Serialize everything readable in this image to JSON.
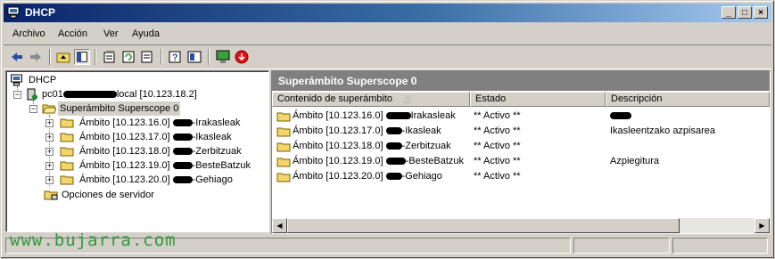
{
  "window": {
    "title": "DHCP",
    "controls": [
      "_",
      "□",
      "×"
    ]
  },
  "menu": {
    "items": [
      {
        "label": "Archivo"
      },
      {
        "label": "Acción"
      },
      {
        "label": "Ver"
      },
      {
        "label": "Ayuda"
      }
    ]
  },
  "toolbar": {
    "buttons": [
      "back-arrow-icon",
      "forward-arrow-icon",
      "up-folder-icon",
      "show-tree-icon",
      "properties-icon",
      "refresh-icon",
      "export-list-icon",
      "help-icon",
      "mmc-help-icon",
      "monitor-icon",
      "stop-icon"
    ]
  },
  "tree": {
    "root": "DHCP",
    "server": {
      "prefix": "pc01",
      "suffix": "local [10.123.18.2]"
    },
    "superscope": "Superámbito Superscope 0",
    "scopes": [
      {
        "pre": "Ámbito [10.123.16.0] ",
        "post": "-Irakasleak"
      },
      {
        "pre": "Ámbito [10.123.17.0] ",
        "post": "-Ikasleak"
      },
      {
        "pre": "Ámbito [10.123.18.0] ",
        "post": "-Zerbitzuak"
      },
      {
        "pre": "Ámbito [10.123.19.0] ",
        "post": "-BesteBatzuk"
      },
      {
        "pre": "Ámbito [10.123.20.0] ",
        "post": "-Gehiago"
      }
    ],
    "server_options": "Opciones de servidor"
  },
  "details": {
    "header": "Superámbito Superscope 0",
    "columns": [
      "Contenido de superámbito",
      "Estado",
      "Descripción"
    ],
    "rows": [
      {
        "name_pre": "Ámbito [10.123.16.0] ",
        "name_post": "Irakasleak",
        "status": "** Activo **",
        "description": ""
      },
      {
        "name_pre": "Ámbito [10.123.17.0] ",
        "name_post": "-Ikasleak",
        "status": "** Activo **",
        "description": "Ikasleentzako azpisarea"
      },
      {
        "name_pre": "Ámbito [10.123.18.0] ",
        "name_post": "-Zerbitzuak",
        "status": "** Activo **",
        "description": ""
      },
      {
        "name_pre": "Ámbito [10.123.19.0] ",
        "name_post": "-BesteBatzuk",
        "status": "** Activo **",
        "description": "Azpiegitura"
      },
      {
        "name_pre": "Ámbito [10.123.20.0] ",
        "name_post": "-Gehiago",
        "status": "** Activo **",
        "description": ""
      }
    ]
  },
  "watermark": "www.bujarra.com",
  "colors": {
    "title_start": "#0a246a",
    "title_end": "#a6caf0",
    "chrome": "#d4d0c8",
    "watermark": "#2e9a3c"
  }
}
